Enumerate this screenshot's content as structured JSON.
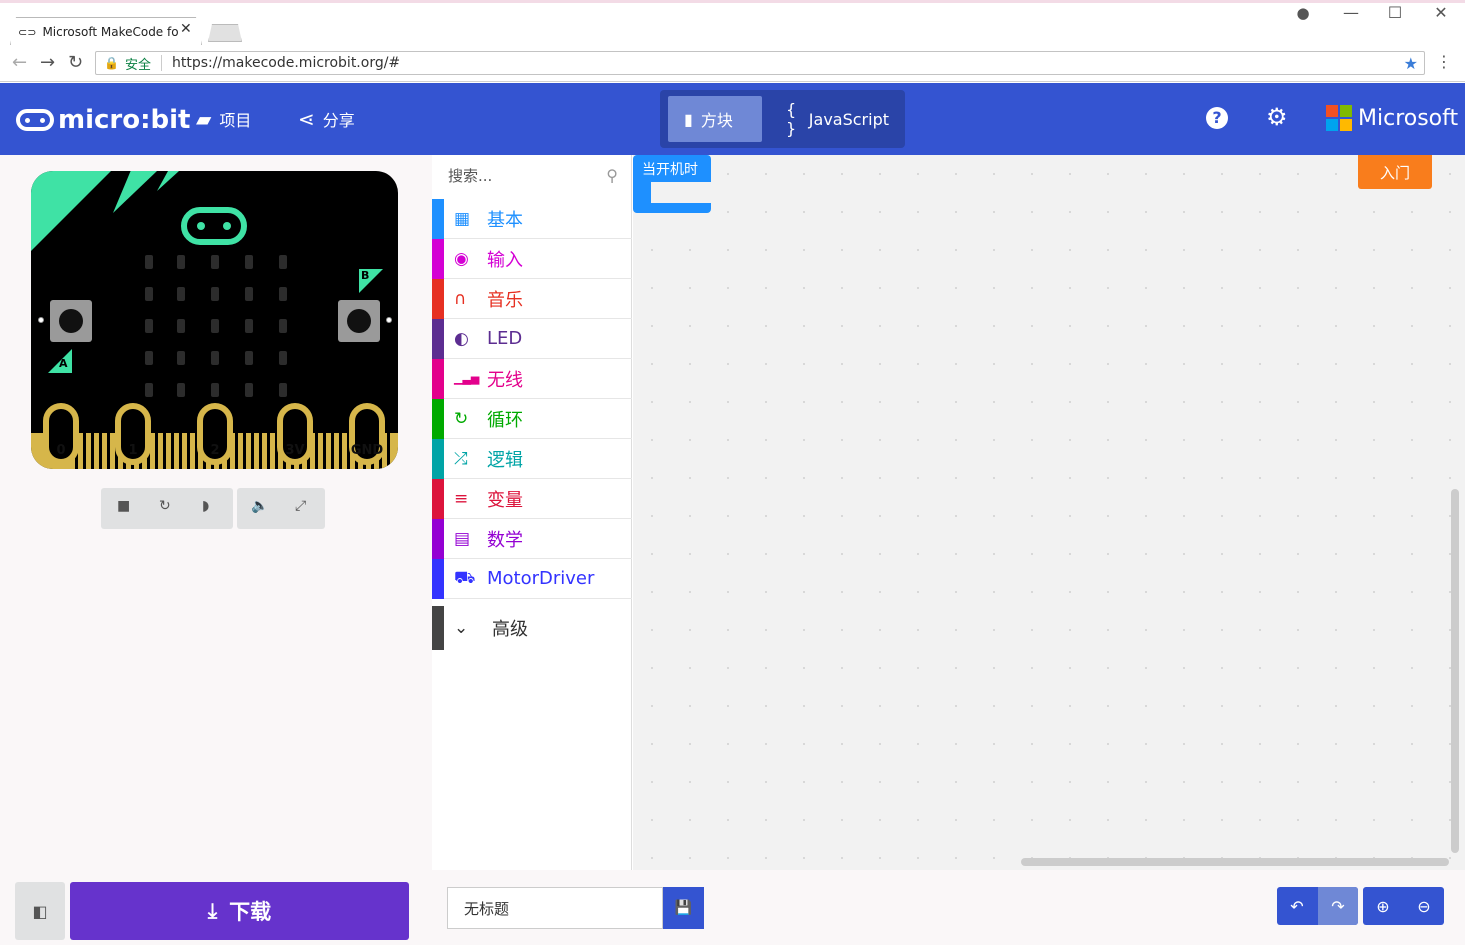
{
  "browser": {
    "tab_title": "Microsoft MakeCode fo",
    "secure_label": "安全",
    "url": "https://makecode.microbit.org/#"
  },
  "header": {
    "logo_text": "micro:bit",
    "projects_label": "项目",
    "share_label": "分享",
    "blocks_label": "方块",
    "javascript_label": "JavaScript",
    "brand": "Microsoft",
    "accent_color": "#3454d1"
  },
  "simulator": {
    "pins": [
      "0",
      "1",
      "2",
      "3V",
      "GND"
    ],
    "button_a": "A",
    "button_b": "B"
  },
  "toolbox": {
    "search_placeholder": "搜索...",
    "categories": [
      {
        "label": "基本",
        "icon": "grid-icon",
        "color": "#1e90ff"
      },
      {
        "label": "输入",
        "icon": "target-icon",
        "color": "#d400d4"
      },
      {
        "label": "音乐",
        "icon": "headphones-icon",
        "color": "#e63022"
      },
      {
        "label": "LED",
        "icon": "toggle-icon",
        "color": "#5c2d91"
      },
      {
        "label": "无线",
        "icon": "signal-icon",
        "color": "#e3008c"
      },
      {
        "label": "循环",
        "icon": "refresh-icon",
        "color": "#00aa00"
      },
      {
        "label": "逻辑",
        "icon": "shuffle-icon",
        "color": "#00a4a6"
      },
      {
        "label": "变量",
        "icon": "list-icon",
        "color": "#dc143c"
      },
      {
        "label": "数学",
        "icon": "calculator-icon",
        "color": "#9400d3"
      },
      {
        "label": "MotorDriver",
        "icon": "car-icon",
        "color": "#3333ff"
      }
    ],
    "advanced_label": "高级"
  },
  "workspace": {
    "on_start_block": "当开机时",
    "intro_button": "入门"
  },
  "footer": {
    "download_label": "下载",
    "project_name": "无标题"
  }
}
